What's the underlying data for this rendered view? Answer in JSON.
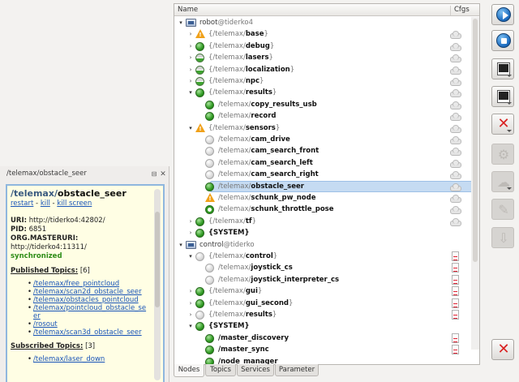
{
  "info_panel": {
    "title": "/telemax/obstacle_seer",
    "min_glyph": "⊟",
    "close_glyph": "✕",
    "node_ns": "/telemax/",
    "node_leaf": "obstacle_seer",
    "actions": {
      "restart": "restart",
      "kill": "kill",
      "kill_screen": "kill screen",
      "separator": " - "
    },
    "uri_label": "URI:",
    "uri_value": "http://tiderko4:42802/",
    "pid_label": "PID:",
    "pid_value": "6851",
    "masteruri_label": "ORG.MASTERURI:",
    "masteruri_value": "http://tiderko4:11311/",
    "sync_status": "synchronized",
    "published_label": "Published Topics:",
    "published_count": "[6]",
    "published_topics": [
      "/telemax/free_pointcloud",
      "/telemax/scan2d_obstacle_seer",
      "/telemax/obstacles_pointcloud",
      "/telemax/pointcloud_obstacle_se",
      "er",
      "/rosout",
      "/telemax/scan3d_obstacle_seer"
    ],
    "subscribed_label": "Subscribed Topics:",
    "subscribed_count": "[3]",
    "subscribed_topics": [
      "/telemax/laser_down"
    ]
  },
  "tree": {
    "col_name": "Name",
    "col_cfgs": "Cfgs",
    "rows": [
      {
        "arrow": "▾",
        "type": "host",
        "host": "robot",
        "hostat": "@tiderko4",
        "indent": 0,
        "cfg": ""
      },
      {
        "arrow": "›",
        "type": "group",
        "status": "warn",
        "ns": "{/telemax/",
        "leaf": "base",
        "close": "}",
        "indent": 1,
        "cfg": "cloud"
      },
      {
        "arrow": "›",
        "type": "group",
        "status": "green",
        "ns": "{/telemax/",
        "leaf": "debug",
        "close": "}",
        "indent": 1,
        "cfg": "cloud"
      },
      {
        "arrow": "›",
        "type": "group",
        "status": "half",
        "ns": "{/telemax/",
        "leaf": "lasers",
        "close": "}",
        "indent": 1,
        "cfg": "cloud"
      },
      {
        "arrow": "›",
        "type": "group",
        "status": "half",
        "ns": "{/telemax/",
        "leaf": "localization",
        "close": "}",
        "indent": 1,
        "cfg": "cloud"
      },
      {
        "arrow": "›",
        "type": "group",
        "status": "half",
        "ns": "{/telemax/",
        "leaf": "npc",
        "close": "}",
        "indent": 1,
        "cfg": "cloud"
      },
      {
        "arrow": "▾",
        "type": "group",
        "status": "green",
        "ns": "{/telemax/",
        "leaf": "results",
        "close": "}",
        "indent": 1,
        "cfg": "cloud"
      },
      {
        "arrow": "",
        "type": "node",
        "status": "green",
        "ns": "/telemax/",
        "leaf": "copy_results_usb",
        "close": "",
        "indent": 2,
        "cfg": "cloud"
      },
      {
        "arrow": "",
        "type": "node",
        "status": "green",
        "ns": "/telemax/",
        "leaf": "record",
        "close": "",
        "indent": 2,
        "cfg": "cloud"
      },
      {
        "arrow": "▾",
        "type": "group",
        "status": "warn",
        "ns": "{/telemax/",
        "leaf": "sensors",
        "close": "}",
        "indent": 1,
        "cfg": "cloud"
      },
      {
        "arrow": "",
        "type": "node",
        "status": "gray",
        "ns": "/telemax/",
        "leaf": "cam_drive",
        "close": "",
        "indent": 2,
        "cfg": "cloud"
      },
      {
        "arrow": "",
        "type": "node",
        "status": "gray",
        "ns": "/telemax/",
        "leaf": "cam_search_front",
        "close": "",
        "indent": 2,
        "cfg": "cloud"
      },
      {
        "arrow": "",
        "type": "node",
        "status": "gray",
        "ns": "/telemax/",
        "leaf": "cam_search_left",
        "close": "",
        "indent": 2,
        "cfg": "cloud"
      },
      {
        "arrow": "",
        "type": "node",
        "status": "gray",
        "ns": "/telemax/",
        "leaf": "cam_search_right",
        "close": "",
        "indent": 2,
        "cfg": "cloud"
      },
      {
        "arrow": "",
        "type": "node",
        "status": "green",
        "ns": "/telemax/",
        "leaf": "obstacle_seer",
        "close": "",
        "indent": 2,
        "cfg": "cloud",
        "selected": true
      },
      {
        "arrow": "",
        "type": "node",
        "status": "warn",
        "ns": "/telemax/",
        "leaf": "schunk_pw_node",
        "close": "",
        "indent": 2,
        "cfg": "cloud"
      },
      {
        "arrow": "",
        "type": "node",
        "status": "ring",
        "ns": "/telemax/",
        "leaf": "schunk_throttle_pose",
        "close": "",
        "indent": 2,
        "cfg": "cloud"
      },
      {
        "arrow": "›",
        "type": "group",
        "status": "green",
        "ns": "{/telemax/",
        "leaf": "tf",
        "close": "}",
        "indent": 1,
        "cfg": "cloud"
      },
      {
        "arrow": "›",
        "type": "group",
        "status": "green",
        "ns": "",
        "leaf": "{SYSTEM}",
        "close": "",
        "indent": 1,
        "cfg": ""
      },
      {
        "arrow": "▾",
        "type": "host",
        "host": "control",
        "hostat": "@tiderko",
        "indent": 0,
        "cfg": ""
      },
      {
        "arrow": "▾",
        "type": "group",
        "status": "gray",
        "ns": "{/telemax/",
        "leaf": "control",
        "close": "}",
        "indent": 1,
        "cfg": "doc"
      },
      {
        "arrow": "",
        "type": "node",
        "status": "gray",
        "ns": "/telemax/",
        "leaf": "joystick_cs",
        "close": "",
        "indent": 2,
        "cfg": "doc"
      },
      {
        "arrow": "",
        "type": "node",
        "status": "gray",
        "ns": "/telemax/",
        "leaf": "joystick_interpreter_cs",
        "close": "",
        "indent": 2,
        "cfg": "doc"
      },
      {
        "arrow": "›",
        "type": "group",
        "status": "green",
        "ns": "{/telemax/",
        "leaf": "gui",
        "close": "}",
        "indent": 1,
        "cfg": "doc"
      },
      {
        "arrow": "›",
        "type": "group",
        "status": "green",
        "ns": "{/telemax/",
        "leaf": "gui_second",
        "close": "}",
        "indent": 1,
        "cfg": "doc"
      },
      {
        "arrow": "›",
        "type": "group",
        "status": "gray",
        "ns": "{/telemax/",
        "leaf": "results",
        "close": "}",
        "indent": 1,
        "cfg": "doc"
      },
      {
        "arrow": "▾",
        "type": "group",
        "status": "green",
        "ns": "",
        "leaf": "{SYSTEM}",
        "close": "",
        "indent": 1,
        "cfg": ""
      },
      {
        "arrow": "",
        "type": "node",
        "status": "green",
        "ns": "",
        "leaf": "/master_discovery",
        "close": "",
        "indent": 2,
        "cfg": "doc"
      },
      {
        "arrow": "",
        "type": "node",
        "status": "green",
        "ns": "",
        "leaf": "/master_sync",
        "close": "",
        "indent": 2,
        "cfg": "doc"
      },
      {
        "arrow": "",
        "type": "node",
        "status": "green",
        "ns": "",
        "leaf": "/node_manager",
        "close": "",
        "indent": 2,
        "cfg": ""
      }
    ]
  },
  "tabs": [
    "Nodes",
    "Topics",
    "Services",
    "Parameter"
  ],
  "active_tab": "Nodes",
  "toolbar": {
    "buttons": [
      {
        "name": "start-button",
        "icon": "play-icon",
        "enabled": true
      },
      {
        "name": "stop-button",
        "icon": "stop-icon",
        "enabled": true
      },
      {
        "name": "terminal-button",
        "icon": "terminal-icon",
        "enabled": true
      },
      {
        "name": "log-button",
        "icon": "log-terminal-icon",
        "enabled": true
      },
      {
        "name": "clear-log-button",
        "icon": "delete-log-icon",
        "enabled": true
      },
      {
        "name": "settings-button",
        "icon": "gear-icon",
        "enabled": false
      },
      {
        "name": "sync-button",
        "icon": "cloud-icon",
        "enabled": false
      },
      {
        "name": "edit-button",
        "icon": "edit-icon",
        "enabled": false
      },
      {
        "name": "save-button",
        "icon": "save-icon",
        "enabled": false
      },
      {
        "name": "close-button",
        "icon": "close-icon",
        "enabled": true
      }
    ],
    "accent": "#1f6fc2",
    "danger": "#d92222"
  }
}
